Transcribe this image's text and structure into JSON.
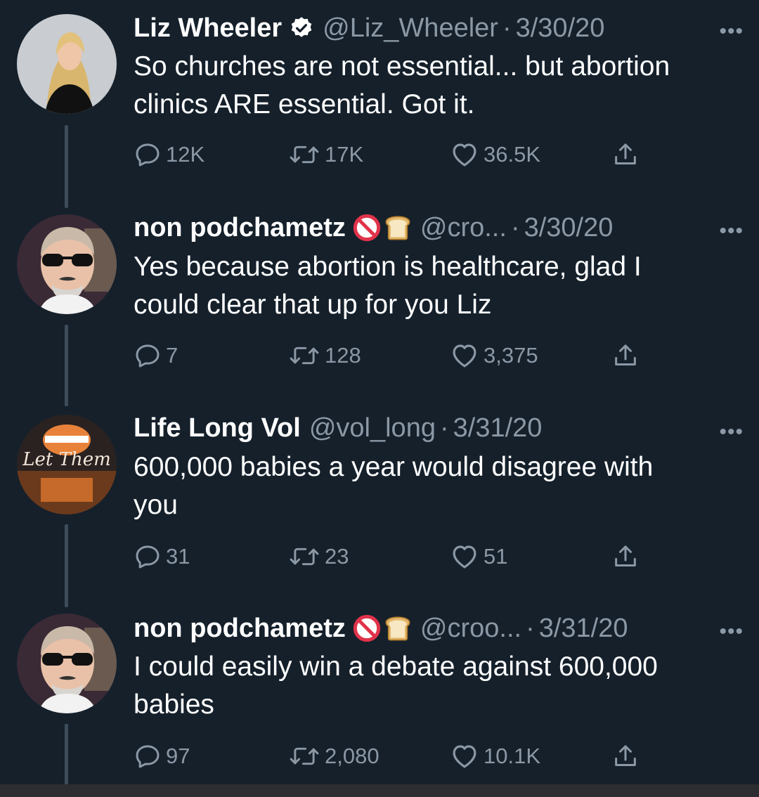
{
  "tweets": [
    {
      "name": "Liz Wheeler",
      "verified": true,
      "handle": "@Liz_Wheeler",
      "date": "3/30/20",
      "text_lines": [
        "So churches are not essential... but abortion",
        "clinics ARE essential. Got it."
      ],
      "replies": "12K",
      "retweets": "17K",
      "likes": "36.5K"
    },
    {
      "name": "non podchametz",
      "badges": [
        "no-entry-icon",
        "bread-icon"
      ],
      "handle": "@cro...",
      "date": "3/30/20",
      "text_lines": [
        "Yes because abortion is healthcare, glad I",
        "could clear that up for you Liz"
      ],
      "replies": "7",
      "retweets": "128",
      "likes": "3,375"
    },
    {
      "name": "Life Long Vol",
      "handle": "@vol_long",
      "date": "3/31/20",
      "avatar_text": "Let Them",
      "text_lines": [
        "600,000 babies a year would disagree with",
        "you"
      ],
      "replies": "31",
      "retweets": "23",
      "likes": "51"
    },
    {
      "name": "non podchametz",
      "badges": [
        "no-entry-icon",
        "bread-icon"
      ],
      "handle": "@croo...",
      "date": "3/31/20",
      "text_lines": [
        "I could easily win a debate against 600,000",
        "babies"
      ],
      "replies": "97",
      "retweets": "2,080",
      "likes": "10.1K"
    }
  ],
  "colors": {
    "background": "#15202b",
    "text": "#ffffff",
    "muted": "#8b98a5",
    "thread_line": "#3d4c5a",
    "no_entry_red": "#e0334a"
  },
  "more_glyph": "•••"
}
